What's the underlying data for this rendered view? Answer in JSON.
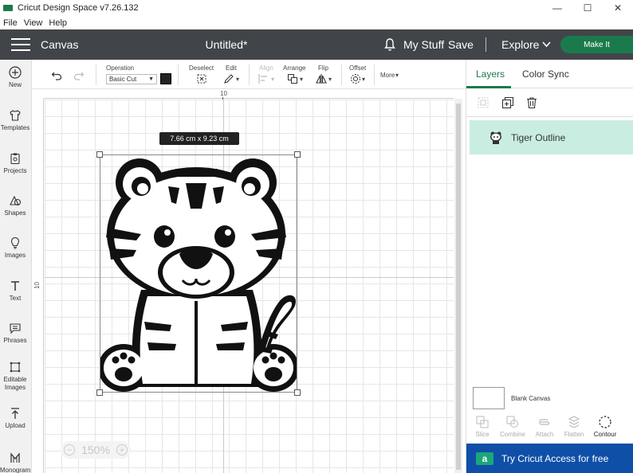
{
  "window": {
    "title": "Cricut Design Space  v7.26.132",
    "min_glyph": "—",
    "max_glyph": "☐",
    "close_glyph": "✕"
  },
  "menu": [
    "File",
    "View",
    "Help"
  ],
  "header": {
    "canvas_label": "Canvas",
    "doc_title": "Untitled*",
    "mystuff": "My Stuff",
    "save": "Save",
    "explore": "Explore",
    "makeit": "Make It"
  },
  "sidebar": {
    "items": [
      {
        "label": "New",
        "icon": "plus-circle-icon"
      },
      {
        "label": "Templates",
        "icon": "shirt-icon"
      },
      {
        "label": "Projects",
        "icon": "clipboard-icon"
      },
      {
        "label": "Shapes",
        "icon": "shapes-icon"
      },
      {
        "label": "Images",
        "icon": "lightbulb-icon"
      },
      {
        "label": "Text",
        "icon": "text-icon"
      },
      {
        "label": "Phrases",
        "icon": "speech-bubble-icon"
      },
      {
        "label": "Editable Images",
        "icon": "editable-image-icon"
      },
      {
        "label": "Upload",
        "icon": "upload-icon"
      },
      {
        "label": "Monogram",
        "icon": "monogram-icon"
      }
    ]
  },
  "toolbar": {
    "operation_label": "Operation",
    "operation_value": "Basic Cut",
    "operation_color": "#222222",
    "deselect": "Deselect",
    "edit": "Edit",
    "align": "Align",
    "arrange": "Arrange",
    "flip": "Flip",
    "offset": "Offset",
    "more": "More"
  },
  "canvas": {
    "ruler_top_mark": "10",
    "ruler_left_mark": "10",
    "size_tag": "7.66  cm x 9.23  cm",
    "zoom": "150%"
  },
  "right_panel": {
    "tabs": [
      "Layers",
      "Color Sync"
    ],
    "active_tab": "Layers",
    "layer_name": "Tiger Outline",
    "blank_canvas": "Blank Canvas",
    "bottom_tools": [
      {
        "label": "Slice",
        "active": false
      },
      {
        "label": "Combine",
        "active": false
      },
      {
        "label": "Attach",
        "active": false
      },
      {
        "label": "Flatten",
        "active": false
      },
      {
        "label": "Contour",
        "active": true
      }
    ],
    "access_badge": "a",
    "access_text": "Try Cricut Access for free"
  },
  "colors": {
    "brand_green": "#1b7a4b",
    "header_bg": "#414549",
    "layer_highlight": "#c9eee1",
    "access_blue": "#0f4fa8"
  }
}
